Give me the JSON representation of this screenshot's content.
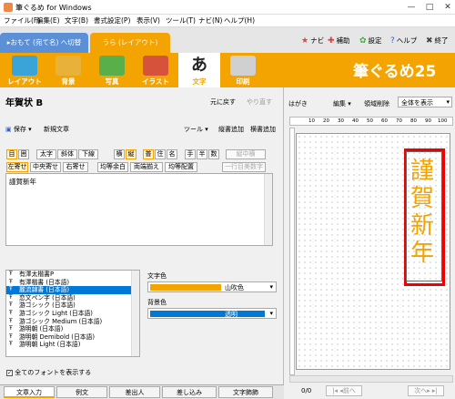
{
  "window": {
    "title": "筆ぐるめ for Windows",
    "controls": [
      "—",
      "□",
      "✕"
    ]
  },
  "menu": [
    "ファイル(F)",
    "編集(E)",
    "文字(B)",
    "書式設定(P)",
    "表示(V)",
    "ツール(T)",
    "ナビ(N)",
    "ヘルプ(H)"
  ],
  "tabs": {
    "front": "▸おもて (宛て名) へ切替",
    "back": "うら (レイアウト)"
  },
  "top_buttons": [
    {
      "icon": "★",
      "label": "ナビ",
      "color": "#d44"
    },
    {
      "icon": "✚",
      "label": "補助",
      "color": "#e33"
    },
    {
      "icon": "✿",
      "label": "設定",
      "color": "#4a4"
    },
    {
      "icon": "?",
      "label": "ヘルプ",
      "color": "#36c"
    },
    {
      "icon": "✖",
      "label": "終了",
      "color": "#444"
    }
  ],
  "tools": [
    "レイアウト",
    "背景",
    "写真",
    "イラスト",
    "文字",
    "印刷"
  ],
  "tool_colors": [
    "#3aa3d8",
    "#e8b13a",
    "#59b04a",
    "#d6523b",
    "#222222",
    "#9a9a9a"
  ],
  "logo": "筆ぐるめ25",
  "left": {
    "heading": "年賀状 B",
    "undo": "元に戻す",
    "redo": "やり直す",
    "save": "保存",
    "new_sentence": "新規文章",
    "tools": "ツール",
    "vert_add": "縦書追加",
    "horz_add": "横書追加",
    "format_row1": [
      "目",
      "囲",
      "太字",
      "斜体",
      "下線",
      "横",
      "縦",
      "普",
      "住",
      "名",
      "手",
      "半",
      "数",
      "縦中横"
    ],
    "format_row2": [
      "左寄せ",
      "中央寄せ",
      "右寄せ",
      "均等余白",
      "両端揃え",
      "均等配置",
      "一行目美数字"
    ],
    "text": "謹賀新年",
    "fonts": [
      "有澤太楷書P",
      "有澤楷書 (日本語)",
      "麗流隷書 (日本語)",
      "恋文ペン字 (日本語)",
      "游ゴシック (日本語)",
      "游ゴシック Light (日本語)",
      "游ゴシック Medium (日本語)",
      "游明朝 (日本語)",
      "游明朝 Demibold (日本語)",
      "游明朝 Light (日本語)"
    ],
    "selected_font_index": 2,
    "text_color_label": "文字色",
    "text_color_value": "山吹色",
    "text_color_hex": "#f3a400",
    "bg_color_label": "背景色",
    "bg_color_value": "透明",
    "show_all_fonts": "全てのフォントを表示する",
    "bottom_tabs": [
      "文章入力",
      "例文",
      "差出人",
      "差し込み",
      "文字飾飾"
    ]
  },
  "right": {
    "paper": "はがき",
    "edit": "編集",
    "region_delete": "領域削除",
    "view": "全体を表示",
    "ruler": [
      "10",
      "20",
      "30",
      "40",
      "50",
      "60",
      "70",
      "80",
      "90",
      "100"
    ],
    "vertical_text": [
      "謹",
      "賀",
      "新",
      "年"
    ],
    "page": "0/0",
    "prev": "前へ",
    "next": "次へ"
  }
}
